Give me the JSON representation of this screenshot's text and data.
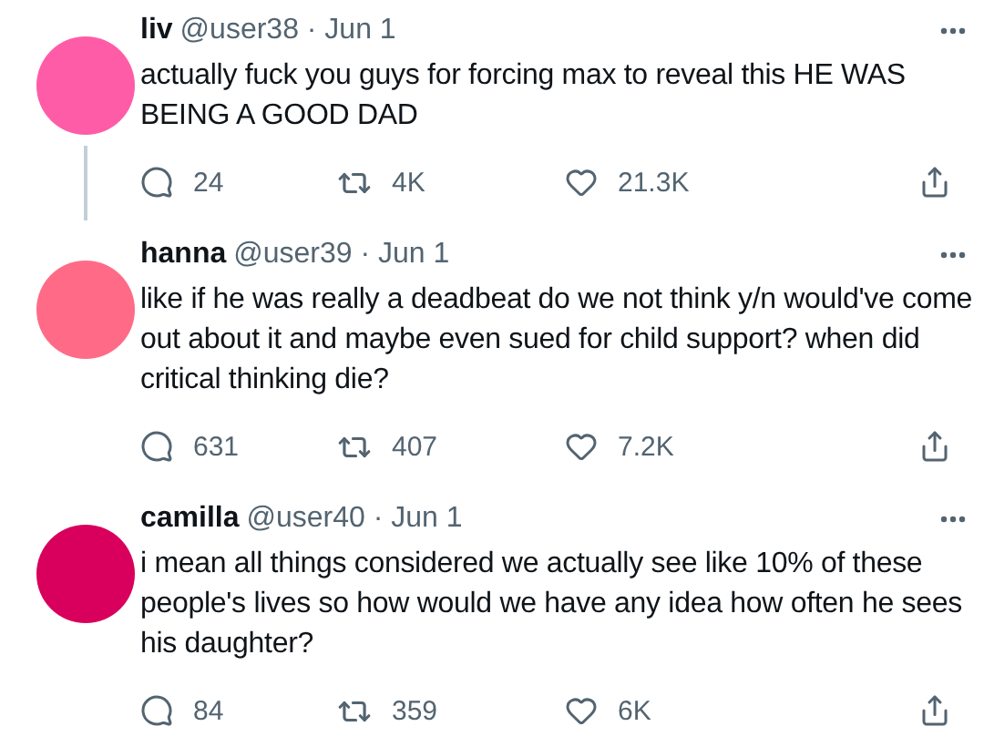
{
  "tweets": [
    {
      "name": "liv",
      "meta": "@user38 · Jun 1",
      "color": "#ff5ca8",
      "thread_line": true,
      "text": "actually fuck you guys for forcing max to reveal this HE WAS BEING A GOOD DAD",
      "replies": "24",
      "retweets": "4K",
      "likes": "21.3K"
    },
    {
      "name": "hanna",
      "meta": "@user39 · Jun 1",
      "color": "#ff6b86",
      "thread_line": false,
      "text": "like if he was really a deadbeat do we not think y/n would've come out about it and maybe even sued for child support? when did critical thinking die?",
      "replies": "631",
      "retweets": "407",
      "likes": "7.2K"
    },
    {
      "name": "camilla",
      "meta": "@user40 · Jun 1",
      "color": "#d8005c",
      "thread_line": false,
      "text": "i mean all things considered we actually see like 10% of these people's lives so how would we have any idea how often he sees his daughter?",
      "replies": "84",
      "retweets": "359",
      "likes": "6K"
    }
  ]
}
